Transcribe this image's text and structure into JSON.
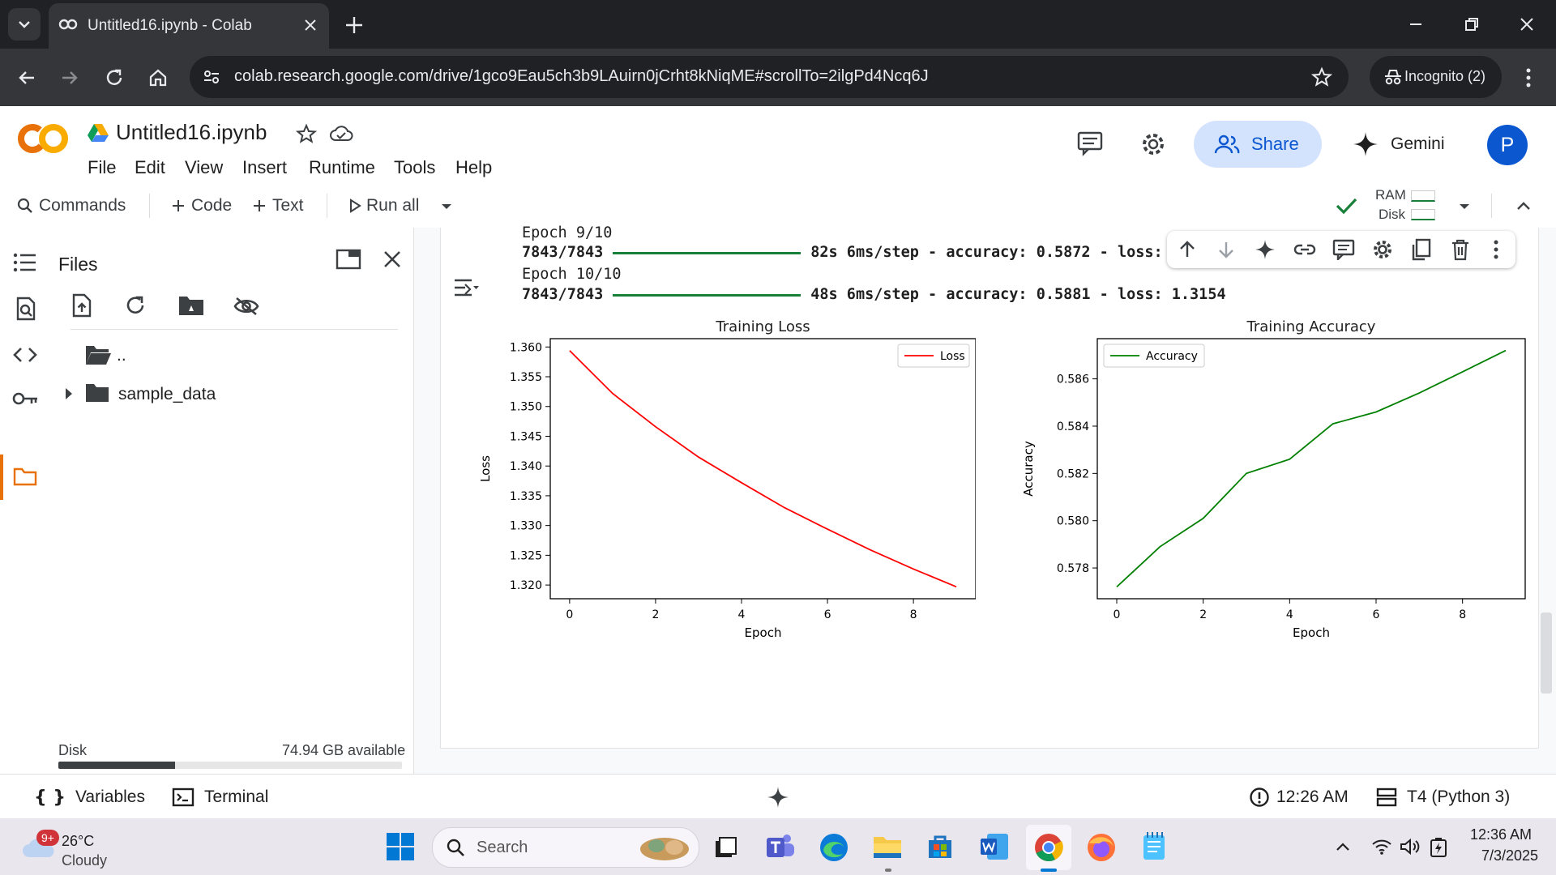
{
  "browser": {
    "tab_title": "Untitled16.ipynb - Colab",
    "url": "colab.research.google.com/drive/1gco9Eau5ch3b9LAuirn0jCrht8kNiqME#scrollTo=2ilgPd4Ncq6J",
    "incognito_label": "Incognito (2)"
  },
  "colab": {
    "logo": "CO",
    "notebook_title": "Untitled16.ipynb",
    "menu": [
      "File",
      "Edit",
      "View",
      "Insert",
      "Runtime",
      "Tools",
      "Help"
    ],
    "share_label": "Share",
    "gemini_label": "Gemini",
    "avatar_initial": "P",
    "toolbar": {
      "commands": "Commands",
      "code": "Code",
      "text": "Text",
      "run_all": "Run all",
      "ram": "RAM",
      "disk": "Disk"
    }
  },
  "files_panel": {
    "title": "Files",
    "parent_dir": "..",
    "folder": "sample_data",
    "disk_label": "Disk",
    "disk_available": "74.94 GB available",
    "disk_used_fraction": 0.34
  },
  "output": {
    "lines": [
      {
        "a": "Epoch 9/10",
        "bold": false
      },
      {
        "a": "7843/7843",
        "b": "82s 6ms/step - accuracy: 0.5872 - loss: 1",
        "bold": true
      },
      {
        "a": "Epoch 10/10",
        "bold": false
      },
      {
        "a": "7843/7843",
        "b": "48s 6ms/step - accuracy: 0.5881 - loss: 1.3154",
        "bold": true
      }
    ]
  },
  "chart_data": [
    {
      "type": "line",
      "title": "Training Loss",
      "xlabel": "Epoch",
      "ylabel": "Loss",
      "x": [
        0,
        1,
        2,
        3,
        4,
        5,
        6,
        7,
        8,
        9
      ],
      "series": [
        {
          "name": "Loss",
          "color": "#ff0000",
          "values": [
            1.3594,
            1.3522,
            1.3466,
            1.3415,
            1.3372,
            1.333,
            1.3294,
            1.3259,
            1.3227,
            1.3197
          ]
        }
      ],
      "xlim": [
        -0.45,
        9.45
      ],
      "ylim": [
        1.3177,
        1.3614
      ],
      "xticks": [
        0,
        2,
        4,
        6,
        8
      ],
      "yticks": [
        1.32,
        1.325,
        1.33,
        1.335,
        1.34,
        1.345,
        1.35,
        1.355,
        1.36
      ],
      "ytick_labels": [
        "1.320",
        "1.325",
        "1.330",
        "1.335",
        "1.340",
        "1.345",
        "1.350",
        "1.355",
        "1.360"
      ],
      "legend": "top-right",
      "grid": false
    },
    {
      "type": "line",
      "title": "Training Accuracy",
      "xlabel": "Epoch",
      "ylabel": "Accuracy",
      "x": [
        0,
        1,
        2,
        3,
        4,
        5,
        6,
        7,
        8,
        9
      ],
      "series": [
        {
          "name": "Accuracy",
          "color": "#008000",
          "values": [
            0.5772,
            0.5789,
            0.5801,
            0.582,
            0.5826,
            0.5841,
            0.5846,
            0.5854,
            0.5863,
            0.5872
          ]
        }
      ],
      "xlim": [
        -0.45,
        9.45
      ],
      "ylim": [
        0.5767,
        0.5877
      ],
      "xticks": [
        0,
        2,
        4,
        6,
        8
      ],
      "yticks": [
        0.578,
        0.58,
        0.582,
        0.584,
        0.586
      ],
      "ytick_labels": [
        "0.578",
        "0.580",
        "0.582",
        "0.584",
        "0.586"
      ],
      "legend": "top-left",
      "grid": false
    }
  ],
  "statusbar": {
    "variables": "Variables",
    "terminal": "Terminal",
    "time": "12:26 AM",
    "runtime": "T4 (Python 3)"
  },
  "taskbar": {
    "weather_badge": "9+",
    "temperature": "26°C",
    "condition": "Cloudy",
    "search_placeholder": "Search",
    "clock_time": "12:36 AM",
    "clock_date": "7/3/2025"
  },
  "colors": {
    "chrome_dark": "#202124",
    "share_bg": "#d3e3fd",
    "accent_orange": "#f9ab00",
    "check_green": "#188038"
  }
}
